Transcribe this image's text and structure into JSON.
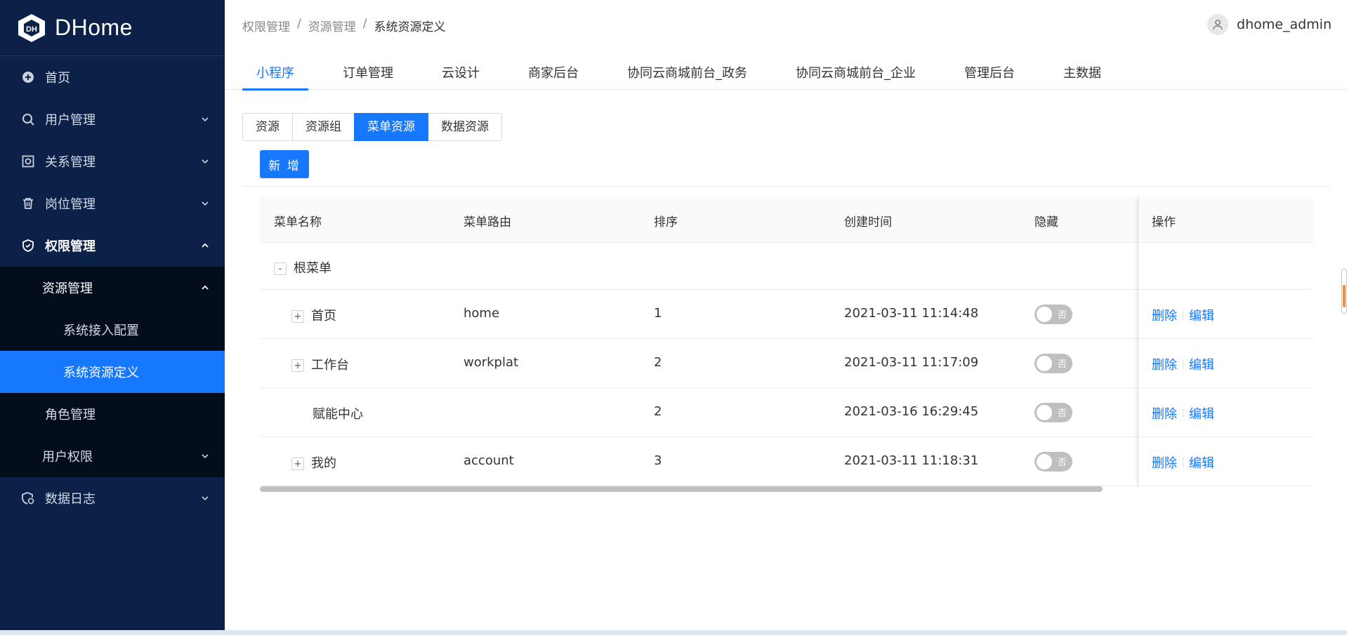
{
  "app": {
    "name": "DHome"
  },
  "sidebar": {
    "items": [
      {
        "label": "首页",
        "icon": "plus-circle-icon"
      },
      {
        "label": "用户管理",
        "icon": "search-icon"
      },
      {
        "label": "关系管理",
        "icon": "relation-icon"
      },
      {
        "label": "岗位管理",
        "icon": "trash-icon"
      },
      {
        "label": "权限管理",
        "icon": "shield-icon"
      },
      {
        "label": "数据日志",
        "icon": "data-log-icon"
      }
    ],
    "submenu": {
      "resource": "资源管理",
      "access_config": "系统接入配置",
      "resource_def": "系统资源定义",
      "role": "角色管理",
      "user_perm": "用户权限"
    }
  },
  "header": {
    "breadcrumb": [
      "权限管理",
      "资源管理",
      "系统资源定义"
    ],
    "separator": "/",
    "user": "dhome_admin"
  },
  "top_tabs": [
    "小程序",
    "订单管理",
    "云设计",
    "商家后台",
    "协同云商城前台_政务",
    "协同云商城前台_企业",
    "管理后台",
    "主数据"
  ],
  "segments": [
    "资源",
    "资源组",
    "菜单资源",
    "数据资源"
  ],
  "add_button": "新 增",
  "table": {
    "columns": [
      "菜单名称",
      "菜单路由",
      "排序",
      "创建时间",
      "隐藏",
      "操作"
    ],
    "root": {
      "expander": "-",
      "name": "根菜单"
    },
    "rows": [
      {
        "expander": "+",
        "name": "首页",
        "route": "home",
        "order": "1",
        "created": "2021-03-11 11:14:48",
        "hidden": "否"
      },
      {
        "expander": "+",
        "name": "工作台",
        "route": "workplat",
        "order": "2",
        "created": "2021-03-11 11:17:09",
        "hidden": "否"
      },
      {
        "expander": "",
        "name": "赋能中心",
        "route": "",
        "order": "2",
        "created": "2021-03-16 16:29:45",
        "hidden": "否"
      },
      {
        "expander": "+",
        "name": "我的",
        "route": "account",
        "order": "3",
        "created": "2021-03-11 11:18:31",
        "hidden": "否"
      }
    ],
    "actions": {
      "delete": "删除",
      "edit": "编辑"
    }
  },
  "colors": {
    "sidebar": "#0c2148",
    "accent": "#1677ff",
    "submenu": "#040d1c"
  }
}
